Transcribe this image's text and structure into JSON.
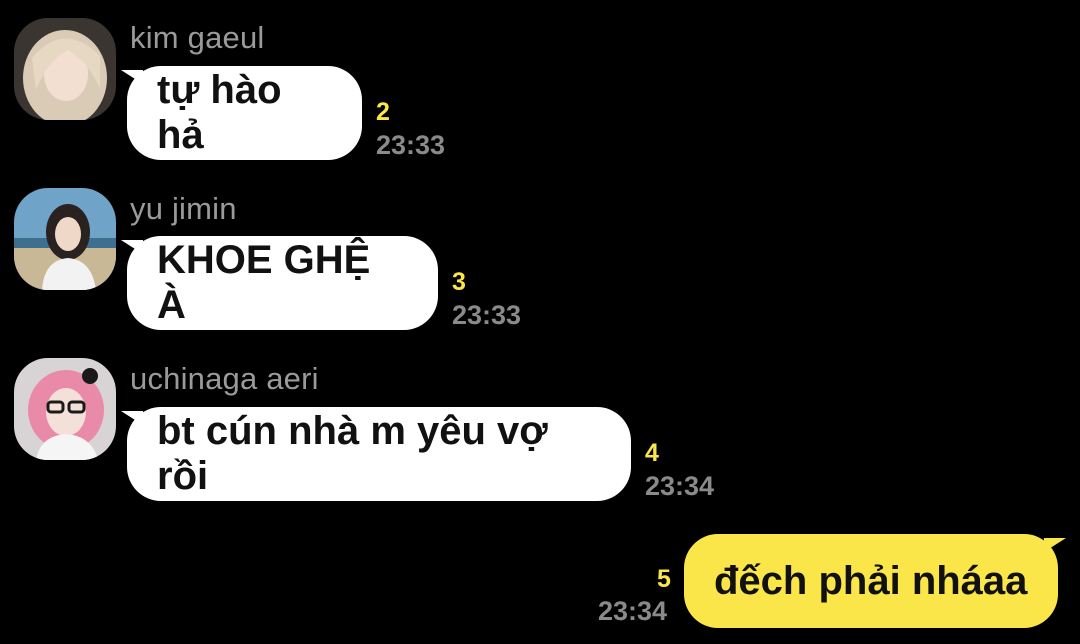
{
  "messages": [
    {
      "sender": "kim gaeul",
      "text": "tự hào hả",
      "unread": "2",
      "time": "23:33",
      "avatar": "avatar-photo"
    },
    {
      "sender": "yu jimin",
      "text": "KHOE GHỆ À",
      "unread": "3",
      "time": "23:33",
      "avatar": "avatar-photo"
    },
    {
      "sender": "uchinaga aeri",
      "text": "bt cún nhà m yêu vợ rồi",
      "unread": "4",
      "time": "23:34",
      "avatar": "avatar-photo"
    }
  ],
  "my_message": {
    "text": "đếch phải nháaa",
    "unread": "5",
    "time": "23:34"
  },
  "colors": {
    "background": "#000000",
    "incoming_bubble": "#ffffff",
    "outgoing_bubble": "#fbe64a",
    "unread_count": "#fbe64a",
    "meta_text": "#8a8a8a"
  }
}
